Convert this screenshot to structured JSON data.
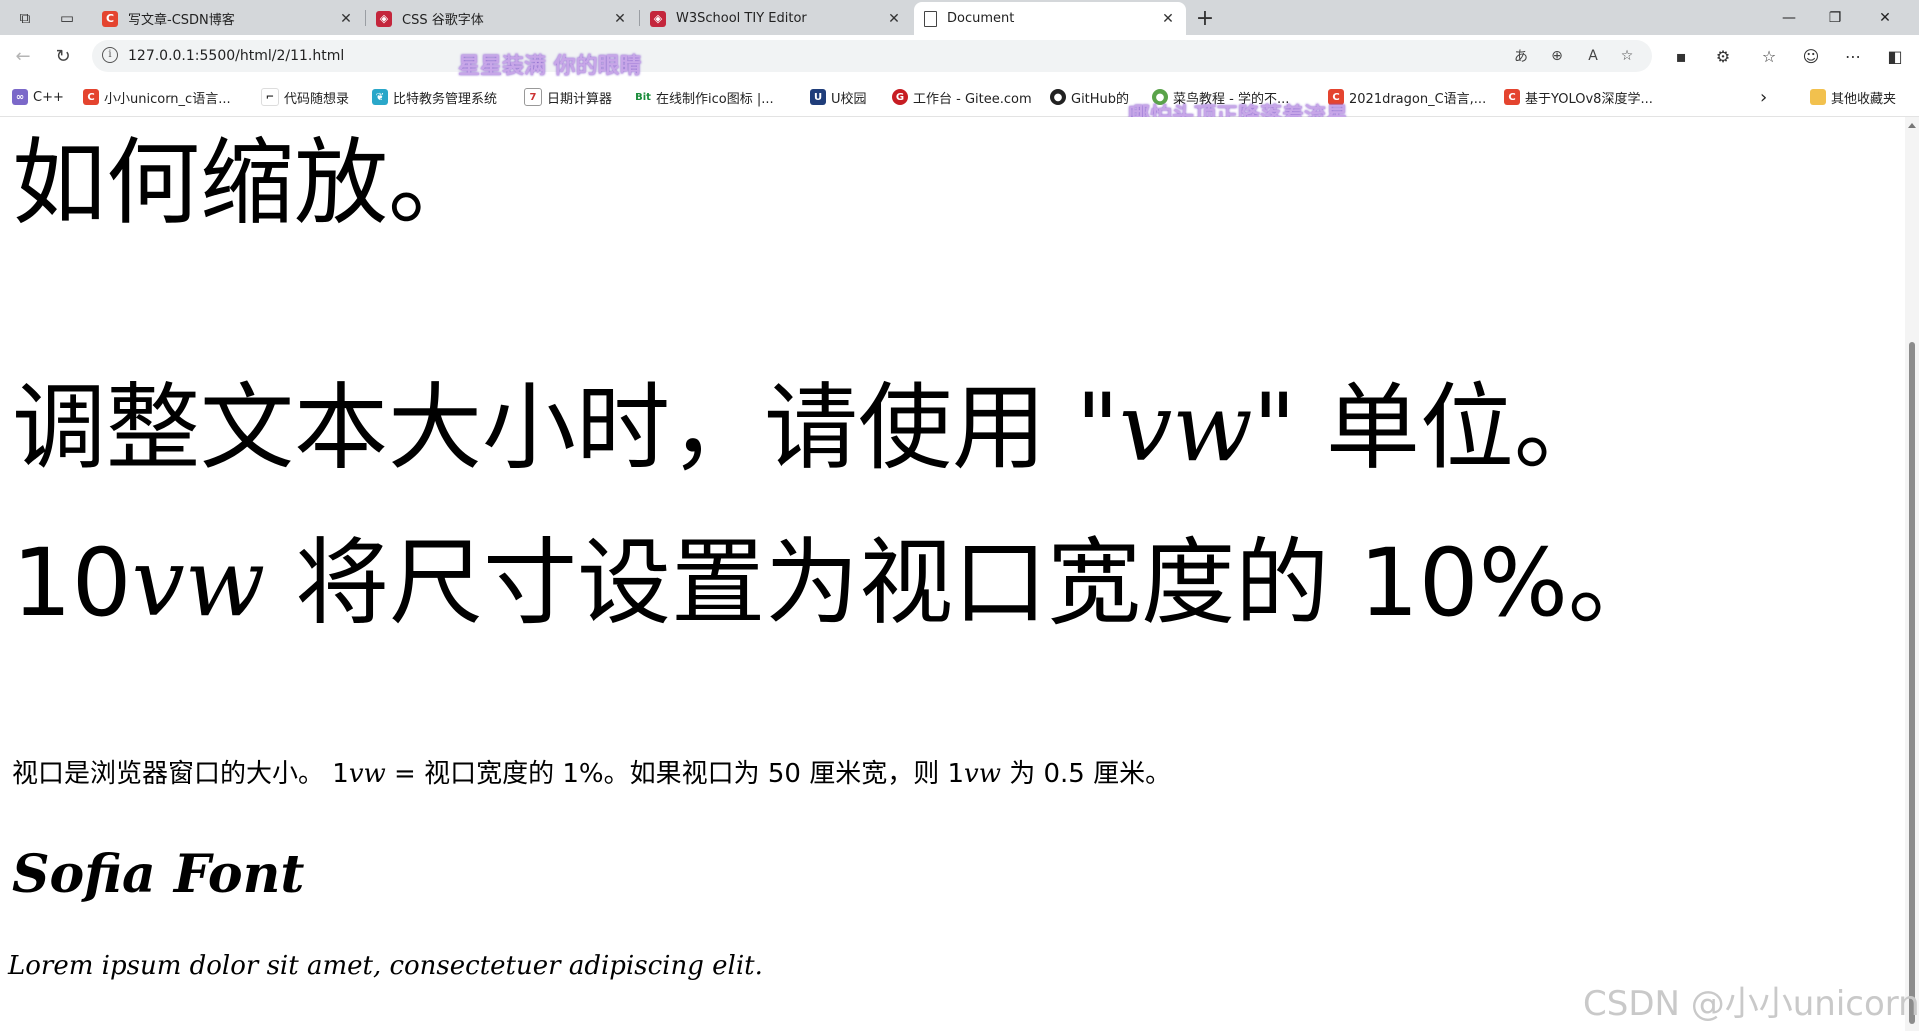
{
  "tabs": [
    {
      "title": "写文章-CSDN博客",
      "favicon": "csdn-icon",
      "color": "#e4442f"
    },
    {
      "title": "CSS 谷歌字体",
      "favicon": "w3school-icon",
      "color": "#c4263c"
    },
    {
      "title": "W3School TIY Editor",
      "favicon": "w3school-icon",
      "color": "#c4263c"
    },
    {
      "title": "Document",
      "favicon": "document-icon",
      "active": true
    }
  ],
  "address": {
    "url": "127.0.0.1:5500/html/2/11.html"
  },
  "bookmarks": [
    {
      "label": "C++",
      "icon": "vs-icon"
    },
    {
      "label": "小小unicorn_c语言...",
      "icon": "csdn-icon"
    },
    {
      "label": "代码随想录",
      "icon": "code-icon"
    },
    {
      "label": "比特教务管理系统",
      "icon": "leaf-icon"
    },
    {
      "label": "日期计算器",
      "icon": "calendar-icon"
    },
    {
      "label": "在线制作ico图标 |...",
      "icon": "bit-icon"
    },
    {
      "label": "U校园",
      "icon": "u-icon"
    },
    {
      "label": "工作台 - Gitee.com",
      "icon": "gitee-icon"
    },
    {
      "label": "GitHub的",
      "icon": "github-icon"
    },
    {
      "label": "菜鸟教程 - 学的不...",
      "icon": "runoob-icon"
    },
    {
      "label": "2021dragon_C语言,...",
      "icon": "csdn-icon"
    },
    {
      "label": "基于YOLOv8深度学...",
      "icon": "csdn-icon"
    }
  ],
  "other_bookmarks": "其他收藏夹",
  "overlay": {
    "line1": "星星装满 你的眼睛",
    "line2": "哪怕头顶正降落着流星"
  },
  "content": {
    "title": "如何缩放。",
    "line2a": "调整文本大小时，请使用 \"",
    "line2unit": "vw",
    "line2b": "\" 单位。",
    "line3num": "10",
    "line3unit": "vw",
    "line3b": " 将尺寸设置为视口宽度的 10%。",
    "para_a": "视口是浏览器窗口的大小。 1",
    "para_unit1": "vw",
    "para_b": " = 视口宽度的 1%。如果视口为 50 厘米宽，则 1",
    "para_unit2": "vw",
    "para_c": " 为 0.5 厘米。",
    "sofia_heading": "Sofia Font",
    "sofia_text": "Lorem ipsum dolor sit amet, consectetuer adipiscing elit."
  },
  "watermark": "CSDN @小小unicorn"
}
